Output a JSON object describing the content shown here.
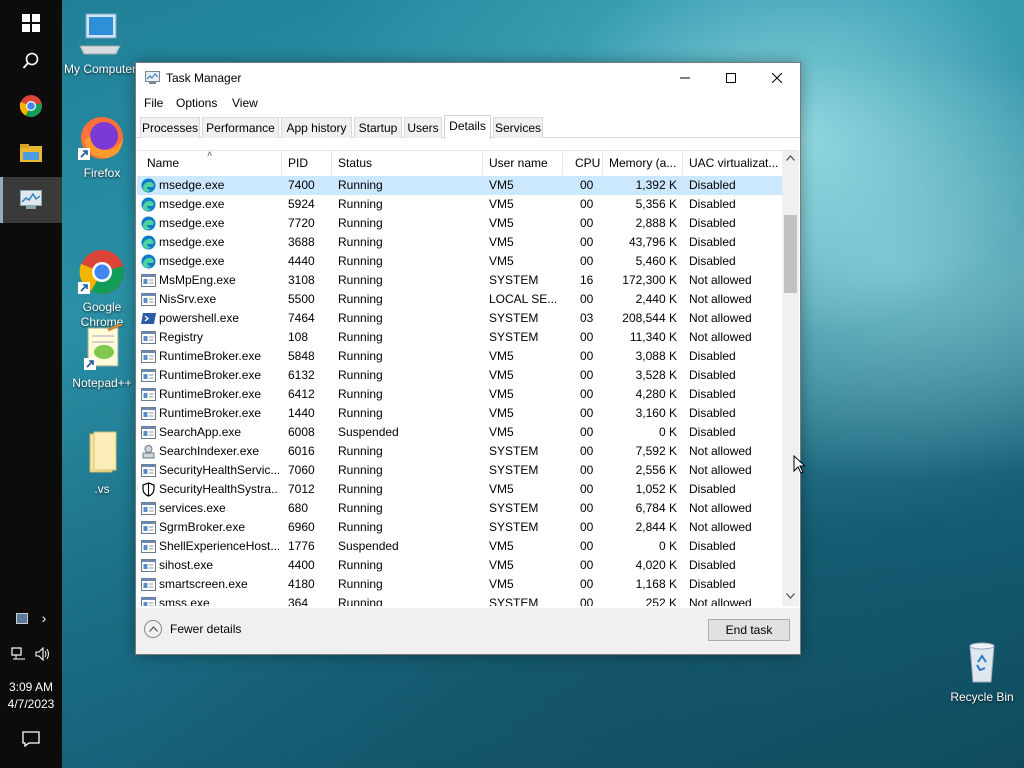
{
  "taskbar": {
    "time": "3:09 AM",
    "date": "4/7/2023",
    "icons": [
      "windows-start-icon",
      "search-icon",
      "chrome-icon",
      "file-explorer-icon",
      "task-manager-icon"
    ]
  },
  "desktop": {
    "icons": [
      {
        "name": "my-computer",
        "label": "My Computer"
      },
      {
        "name": "firefox",
        "label": "Firefox"
      },
      {
        "name": "google-chrome",
        "label": "Google\nChrome"
      },
      {
        "name": "notepad-plus-plus",
        "label": "Notepad++"
      },
      {
        "name": "vs-folder",
        "label": ".vs"
      },
      {
        "name": "recycle-bin",
        "label": "Recycle Bin"
      }
    ]
  },
  "window": {
    "title": "Task Manager",
    "menu": [
      "File",
      "Options",
      "View"
    ],
    "tabs": [
      "Processes",
      "Performance",
      "App history",
      "Startup",
      "Users",
      "Details",
      "Services"
    ],
    "selected_tab": "Details",
    "columns": [
      "Name",
      "PID",
      "Status",
      "User name",
      "CPU",
      "Memory (a...",
      "UAC virtualizat..."
    ],
    "rows": [
      {
        "icon": "edge",
        "name": "msedge.exe",
        "pid": "7400",
        "status": "Running",
        "user": "VM5",
        "cpu": "00",
        "mem": "1,392 K",
        "uac": "Disabled"
      },
      {
        "icon": "edge",
        "name": "msedge.exe",
        "pid": "5924",
        "status": "Running",
        "user": "VM5",
        "cpu": "00",
        "mem": "5,356 K",
        "uac": "Disabled"
      },
      {
        "icon": "edge",
        "name": "msedge.exe",
        "pid": "7720",
        "status": "Running",
        "user": "VM5",
        "cpu": "00",
        "mem": "2,888 K",
        "uac": "Disabled"
      },
      {
        "icon": "edge",
        "name": "msedge.exe",
        "pid": "3688",
        "status": "Running",
        "user": "VM5",
        "cpu": "00",
        "mem": "43,796 K",
        "uac": "Disabled"
      },
      {
        "icon": "edge",
        "name": "msedge.exe",
        "pid": "4440",
        "status": "Running",
        "user": "VM5",
        "cpu": "00",
        "mem": "5,460 K",
        "uac": "Disabled"
      },
      {
        "icon": "generic",
        "name": "MsMpEng.exe",
        "pid": "3108",
        "status": "Running",
        "user": "SYSTEM",
        "cpu": "16",
        "mem": "172,300 K",
        "uac": "Not allowed"
      },
      {
        "icon": "generic",
        "name": "NisSrv.exe",
        "pid": "5500",
        "status": "Running",
        "user": "LOCAL SE...",
        "cpu": "00",
        "mem": "2,440 K",
        "uac": "Not allowed"
      },
      {
        "icon": "powershell",
        "name": "powershell.exe",
        "pid": "7464",
        "status": "Running",
        "user": "SYSTEM",
        "cpu": "03",
        "mem": "208,544 K",
        "uac": "Not allowed"
      },
      {
        "icon": "generic",
        "name": "Registry",
        "pid": "108",
        "status": "Running",
        "user": "SYSTEM",
        "cpu": "00",
        "mem": "11,340 K",
        "uac": "Not allowed"
      },
      {
        "icon": "generic",
        "name": "RuntimeBroker.exe",
        "pid": "5848",
        "status": "Running",
        "user": "VM5",
        "cpu": "00",
        "mem": "3,088 K",
        "uac": "Disabled"
      },
      {
        "icon": "generic",
        "name": "RuntimeBroker.exe",
        "pid": "6132",
        "status": "Running",
        "user": "VM5",
        "cpu": "00",
        "mem": "3,528 K",
        "uac": "Disabled"
      },
      {
        "icon": "generic",
        "name": "RuntimeBroker.exe",
        "pid": "6412",
        "status": "Running",
        "user": "VM5",
        "cpu": "00",
        "mem": "4,280 K",
        "uac": "Disabled"
      },
      {
        "icon": "generic",
        "name": "RuntimeBroker.exe",
        "pid": "1440",
        "status": "Running",
        "user": "VM5",
        "cpu": "00",
        "mem": "3,160 K",
        "uac": "Disabled"
      },
      {
        "icon": "generic",
        "name": "SearchApp.exe",
        "pid": "6008",
        "status": "Suspended",
        "user": "VM5",
        "cpu": "00",
        "mem": "0 K",
        "uac": "Disabled"
      },
      {
        "icon": "search-indexer",
        "name": "SearchIndexer.exe",
        "pid": "6016",
        "status": "Running",
        "user": "SYSTEM",
        "cpu": "00",
        "mem": "7,592 K",
        "uac": "Not allowed"
      },
      {
        "icon": "generic",
        "name": "SecurityHealthServic...",
        "pid": "7060",
        "status": "Running",
        "user": "SYSTEM",
        "cpu": "00",
        "mem": "2,556 K",
        "uac": "Not allowed"
      },
      {
        "icon": "shield",
        "name": "SecurityHealthSystra...",
        "pid": "7012",
        "status": "Running",
        "user": "VM5",
        "cpu": "00",
        "mem": "1,052 K",
        "uac": "Disabled"
      },
      {
        "icon": "generic",
        "name": "services.exe",
        "pid": "680",
        "status": "Running",
        "user": "SYSTEM",
        "cpu": "00",
        "mem": "6,784 K",
        "uac": "Not allowed"
      },
      {
        "icon": "generic",
        "name": "SgrmBroker.exe",
        "pid": "6960",
        "status": "Running",
        "user": "SYSTEM",
        "cpu": "00",
        "mem": "2,844 K",
        "uac": "Not allowed"
      },
      {
        "icon": "generic",
        "name": "ShellExperienceHost....",
        "pid": "1776",
        "status": "Suspended",
        "user": "VM5",
        "cpu": "00",
        "mem": "0 K",
        "uac": "Disabled"
      },
      {
        "icon": "generic",
        "name": "sihost.exe",
        "pid": "4400",
        "status": "Running",
        "user": "VM5",
        "cpu": "00",
        "mem": "4,020 K",
        "uac": "Disabled"
      },
      {
        "icon": "generic",
        "name": "smartscreen.exe",
        "pid": "4180",
        "status": "Running",
        "user": "VM5",
        "cpu": "00",
        "mem": "1,168 K",
        "uac": "Disabled"
      },
      {
        "icon": "generic",
        "name": "smss.exe",
        "pid": "364",
        "status": "Running",
        "user": "SYSTEM",
        "cpu": "00",
        "mem": "252 K",
        "uac": "Not allowed"
      }
    ],
    "fewer_details": "Fewer details",
    "end_task": "End task"
  },
  "colors": {
    "selection": "#cce8ff",
    "taskbar": "#0c0c0c"
  }
}
